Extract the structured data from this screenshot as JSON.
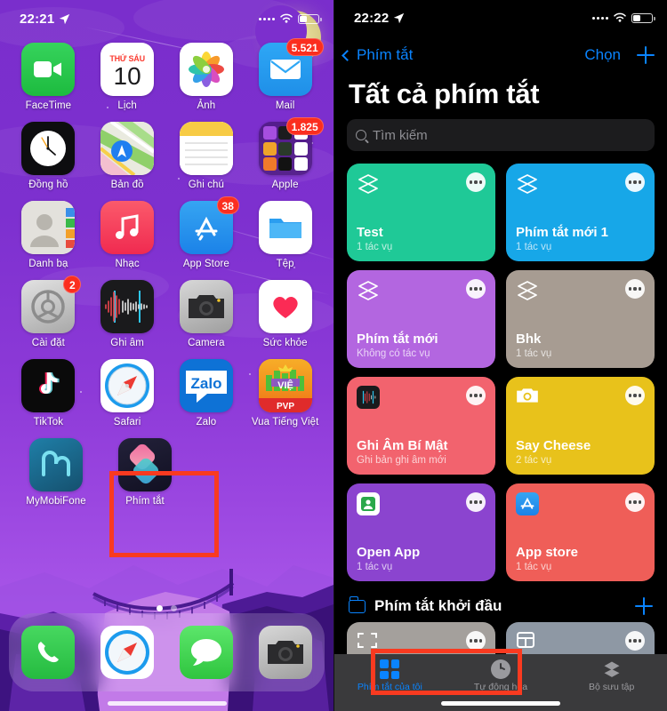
{
  "left_phone": {
    "status_bar": {
      "time": "22:21",
      "location_icon": "location-arrow-icon",
      "wifi_icon": "wifi-icon",
      "battery_icon": "battery-icon"
    },
    "rows": [
      [
        {
          "label": "FaceTime",
          "icon": "facetime-icon",
          "badge": null
        },
        {
          "label": "Lịch",
          "icon": "calendar-icon",
          "badge": null,
          "cal_day_name": "THỨ SÁU",
          "cal_day_num": "10"
        },
        {
          "label": "Ảnh",
          "icon": "photos-icon",
          "badge": null
        },
        {
          "label": "Mail",
          "icon": "mail-icon",
          "badge": "5.521"
        }
      ],
      [
        {
          "label": "Đồng hồ",
          "icon": "clock-icon",
          "badge": null
        },
        {
          "label": "Bản đồ",
          "icon": "maps-icon",
          "badge": null
        },
        {
          "label": "Ghi chú",
          "icon": "notes-icon",
          "badge": null
        },
        {
          "label": "Apple",
          "icon": "apple-folder-icon",
          "badge": "1.825"
        }
      ],
      [
        {
          "label": "Danh bạ",
          "icon": "contacts-icon",
          "badge": null
        },
        {
          "label": "Nhạc",
          "icon": "music-icon",
          "badge": null
        },
        {
          "label": "App Store",
          "icon": "appstore-icon",
          "badge": "38"
        },
        {
          "label": "Tệp",
          "icon": "files-icon",
          "badge": null
        }
      ],
      [
        {
          "label": "Cài đặt",
          "icon": "settings-gear-icon",
          "badge": "2"
        },
        {
          "label": "Ghi âm",
          "icon": "voice-memos-icon",
          "badge": null
        },
        {
          "label": "Camera",
          "icon": "camera-icon",
          "badge": null
        },
        {
          "label": "Sức khỏe",
          "icon": "health-heart-icon",
          "badge": null
        }
      ],
      [
        {
          "label": "TikTok",
          "icon": "tiktok-icon",
          "badge": null
        },
        {
          "label": "Safari",
          "icon": "safari-compass-icon",
          "badge": null
        },
        {
          "label": "Zalo",
          "icon": "zalo-icon",
          "badge": null
        },
        {
          "label": "Vua Tiếng Việt",
          "icon": "vua-tieng-viet-icon",
          "badge": null,
          "sub_label": "PVP"
        }
      ],
      [
        {
          "label": "MyMobiFone",
          "icon": "mymobifone-icon",
          "badge": null
        },
        {
          "label": "Phím tắt",
          "icon": "shortcuts-icon",
          "badge": null,
          "highlighted": true
        }
      ]
    ],
    "page_dots": {
      "count": 2,
      "active_index": 0
    },
    "dock": [
      {
        "label": "Phone",
        "icon": "phone-icon"
      },
      {
        "label": "Safari",
        "icon": "safari-compass-icon"
      },
      {
        "label": "Messages",
        "icon": "messages-icon"
      },
      {
        "label": "Camera",
        "icon": "camera-icon"
      }
    ],
    "highlight_color": "#f93a20"
  },
  "right_phone": {
    "status_bar": {
      "time": "22:22",
      "location_icon": "location-arrow-icon",
      "wifi_icon": "wifi-icon",
      "battery_icon": "battery-icon"
    },
    "nav": {
      "back_label": "Phím tắt",
      "back_icon": "chevron-left-icon",
      "choose_label": "Chọn",
      "add_icon": "plus-icon"
    },
    "title": "Tất cả phím tắt",
    "search": {
      "placeholder": "Tìm kiếm",
      "icon": "search-icon"
    },
    "shortcuts": [
      {
        "name": "Test",
        "sub": "1 tác vụ",
        "color": "#1fc997",
        "icon": "layers-icon"
      },
      {
        "name": "Phím tắt mới 1",
        "sub": "1 tác vụ",
        "color": "#17a7e8",
        "icon": "layers-icon"
      },
      {
        "name": "Phím tắt mới",
        "sub": "Không có tác vụ",
        "color": "#b366e0",
        "icon": "layers-icon"
      },
      {
        "name": "Bhk",
        "sub": "1 tác vụ",
        "color": "#a79c92",
        "icon": "layers-icon"
      },
      {
        "name": "Ghi Âm Bí Mật",
        "sub": "Ghi bản ghi âm mới",
        "color": "#f2636e",
        "icon": "voice-memos-icon"
      },
      {
        "name": "Say Cheese",
        "sub": "2 tác vụ",
        "color": "#e8c21b",
        "icon": "camera-icon"
      },
      {
        "name": "Open App",
        "sub": "1 tác vụ",
        "color": "#8b44cf",
        "icon": "app-grid-icon"
      },
      {
        "name": "App store",
        "sub": "1 tác vụ",
        "color": "#ef5e58",
        "icon": "appstore-icon"
      }
    ],
    "folder_section": {
      "title": "Phím tắt khởi đầu",
      "folder_icon": "folder-icon",
      "add_icon": "plus-icon"
    },
    "tabs": [
      {
        "label": "Phím tắt của tôi",
        "icon": "grid-icon",
        "active": true
      },
      {
        "label": "Tự động hóa",
        "icon": "clock-icon",
        "active": false,
        "highlighted": true
      },
      {
        "label": "Bộ sưu tập",
        "icon": "layers-icon",
        "active": false
      }
    ],
    "highlight_color": "#f93a20",
    "accent_color": "#0a84ff"
  }
}
